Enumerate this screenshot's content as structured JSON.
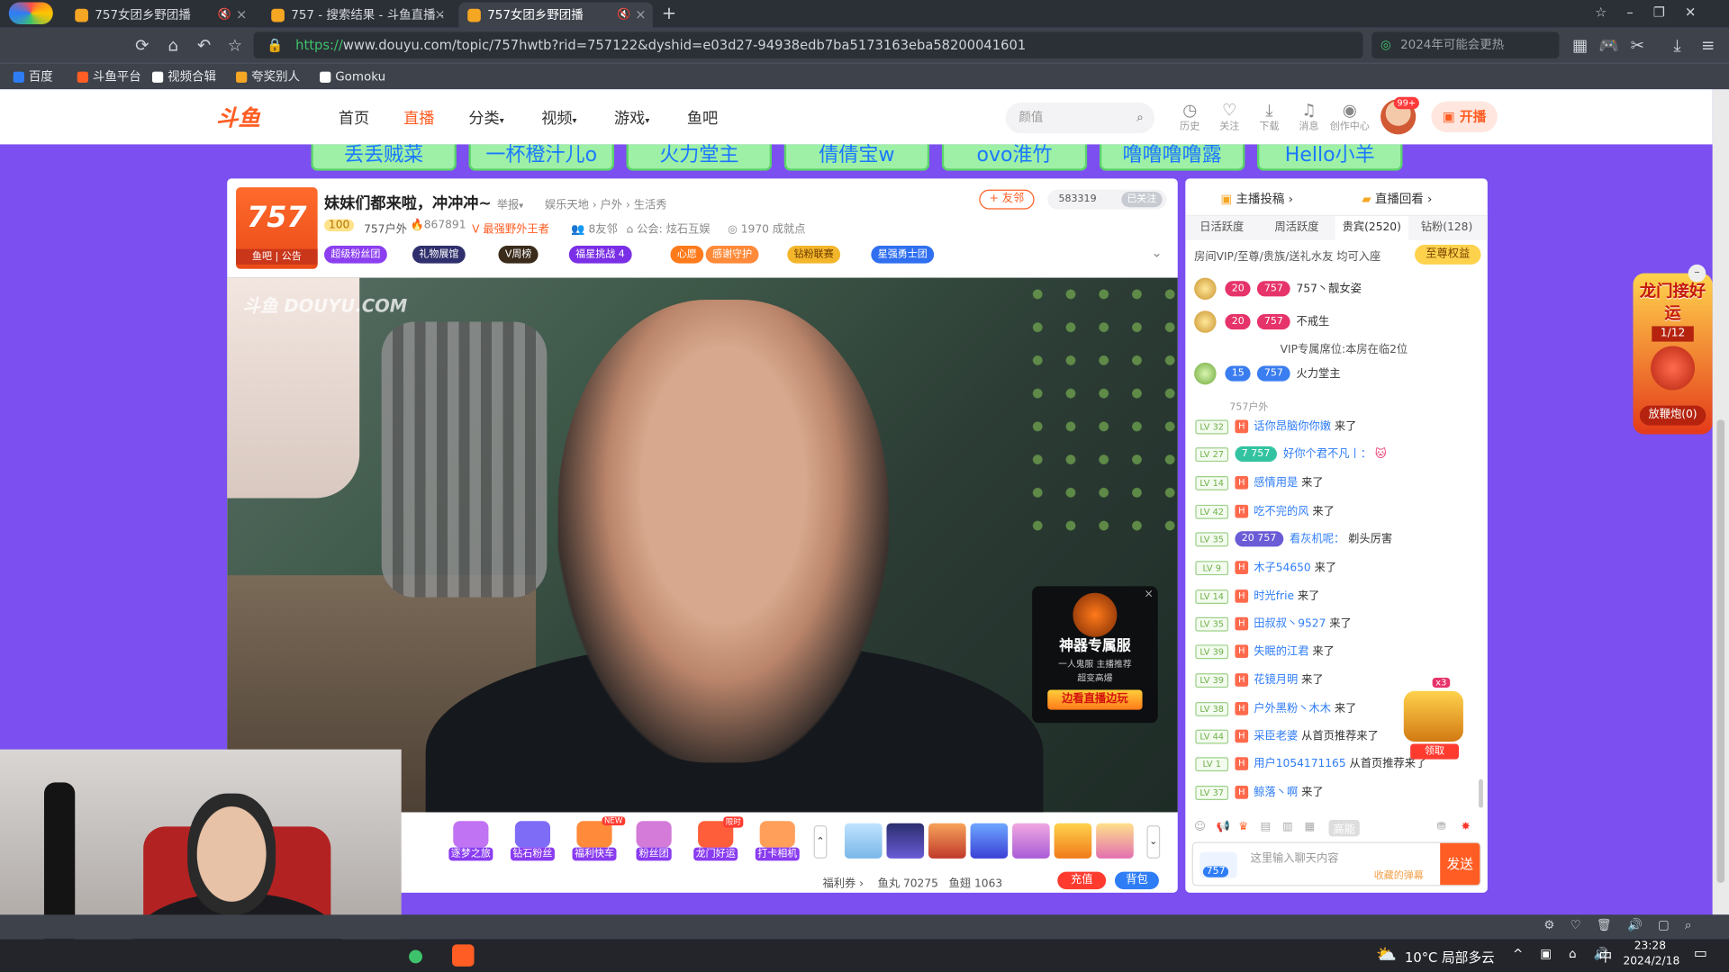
{
  "browser": {
    "tabs": [
      {
        "label": "757女团乡野团播",
        "active": false
      },
      {
        "label": "757 - 搜索结果 - 斗鱼直播 -",
        "active": false
      },
      {
        "label": "757女团乡野团播",
        "active": true
      }
    ],
    "new_tab": "+",
    "url_scheme": "https://",
    "url_rest": "www.douyu.com/topic/757hwtb?rid=757122&dyshid=e03d27-94938edb7ba5173163eba58200041601",
    "search_placeholder": "2024年可能会更热",
    "bookmarks": [
      "百度",
      "斗鱼平台",
      "视频合辑",
      "夸奖别人",
      "Gomoku"
    ]
  },
  "site": {
    "logo": "斗鱼",
    "nav": [
      "首页",
      "直播",
      "分类",
      "视频",
      "游戏",
      "鱼吧"
    ],
    "nav_current": 1,
    "search_placeholder": "颜值",
    "header_icons": [
      {
        "name": "history-icon",
        "label": "历史"
      },
      {
        "name": "heart-icon",
        "label": "关注"
      },
      {
        "name": "download-icon",
        "label": "下载"
      },
      {
        "name": "bell-icon",
        "label": "消息"
      },
      {
        "name": "bulb-icon",
        "label": "创作中心"
      }
    ],
    "avatar_badge": "99+",
    "open_live": "开播"
  },
  "name_strip": [
    "丢丢贼菜",
    "一杯橙汁儿o",
    "火力堂主",
    "倩倩宝w",
    "ovo淮竹",
    "噜噜噜噜露",
    "Hello小羊"
  ],
  "room": {
    "logo_text": "757",
    "logo_sub": "鱼吧 | 公告",
    "title": "妹妹们都来啦，冲冲冲~",
    "report": "举报",
    "category": "娱乐天地 › 户外 › 生活秀",
    "level": "100",
    "anchor": "757户外",
    "hot": "867891",
    "tag": "最强野外王者",
    "friends": "8友邻",
    "guild": "公会: 炫石互娱",
    "achievements": "1970 成就点",
    "follow_btn": "+ 友邻",
    "fans_count": "583319",
    "followed_label": "已关注",
    "chips": [
      "超级粉丝团",
      "礼物展馆",
      "V周榜",
      "福星挑战 4",
      "心愿",
      "感谢守护",
      "钻粉联赛",
      "星强勇士团"
    ],
    "watermark": "斗鱼 DOUYU.COM"
  },
  "ad_popup": {
    "title": "神器专属服",
    "tags": [
      "一人鬼服",
      "主播推荐",
      "超变高爆"
    ],
    "button": "边看直播边玩",
    "close": "×"
  },
  "gifts": [
    {
      "label": "逐梦之旅",
      "color": "#c073f2"
    },
    {
      "label": "钻石粉丝",
      "color": "#7f6cf6"
    },
    {
      "label": "福利快车",
      "color": "#ff8a3a"
    },
    {
      "label": "粉丝团",
      "color": "#d47bd9"
    },
    {
      "label": "龙门好运",
      "color": "#ff5e3a"
    },
    {
      "label": "打卡相机",
      "color": "#ff9f5a"
    }
  ],
  "gift_badges": {
    "new": "NEW",
    "limited": "限时"
  },
  "bottom_stats": {
    "coupon": "福利券 ›",
    "fishball": "鱼丸 70275",
    "fishfin": "鱼翅 1063",
    "charge": "充值",
    "bag": "背包"
  },
  "right_panel": {
    "top_tabs": [
      "主播投稿 ›",
      "直播回看 ›"
    ],
    "tabs": [
      "日活跃度",
      "周活跃度",
      "贵宾(2520)",
      "钻粉(128)"
    ],
    "tab_current": 2,
    "vip_text": "房间VIP/至尊/贵族/送礼水友 均可入座",
    "vip_btn": "至尊权益",
    "ranks": [
      {
        "level": "20",
        "club": "757",
        "name": "757丶靓女姿"
      },
      {
        "level": "20",
        "club": "757",
        "name": "不戒生"
      },
      {
        "level": "15",
        "club": "757",
        "name": "火力堂主"
      }
    ],
    "vip_seat": "VIP专属席位:本房在临2位",
    "partial_name": "757户外",
    "chat": [
      {
        "lv": "LV 32",
        "name": "话你昂脑你你嫩",
        "text": "来了"
      },
      {
        "lv": "LV 27",
        "club": "7  757",
        "name": "好你个君不凡丨：",
        "text": ""
      },
      {
        "lv": "LV 14",
        "name": "感情用是",
        "text": "来了"
      },
      {
        "lv": "LV 42",
        "name": "吃不完的风",
        "text": "来了"
      },
      {
        "lv": "LV 35",
        "club": "20  757",
        "name": "看灰机呢：",
        "text": "剃头厉害"
      },
      {
        "lv": "LV 9",
        "name": "木子54650",
        "text": "来了"
      },
      {
        "lv": "LV 14",
        "name": "时光frie",
        "text": "来了"
      },
      {
        "lv": "LV 35",
        "name": "田叔叔丶9527",
        "text": "来了"
      },
      {
        "lv": "LV 39",
        "name": "失眠的江君",
        "text": "来了"
      },
      {
        "lv": "LV 39",
        "name": "花镜月明",
        "text": "来了"
      },
      {
        "lv": "LV 38",
        "name": "户外黑粉丶木木",
        "text": "来了"
      },
      {
        "lv": "LV 44",
        "name": "采臣老婆",
        "text": "从首页推荐来了"
      },
      {
        "lv": "LV 1",
        "name": "用户1054171165",
        "text": "从首页推荐来了"
      },
      {
        "lv": "LV 37",
        "name": "鲸落丶啊",
        "text": "来了"
      }
    ],
    "treasure_count": "x3",
    "treasure_btn": "领取",
    "input_placeholder": "这里输入聊天内容",
    "input_hint": "收藏的弹幕",
    "input_badge": "757",
    "send": "发送",
    "tool_label": "高能"
  },
  "promo": {
    "title": "龙门接好运",
    "count": "1/12",
    "button": "放鞭炮(0)"
  },
  "taskbar": {
    "weather": "10°C 局部多云",
    "time": "23:28",
    "date": "2024/2/18",
    "ime": "中"
  }
}
